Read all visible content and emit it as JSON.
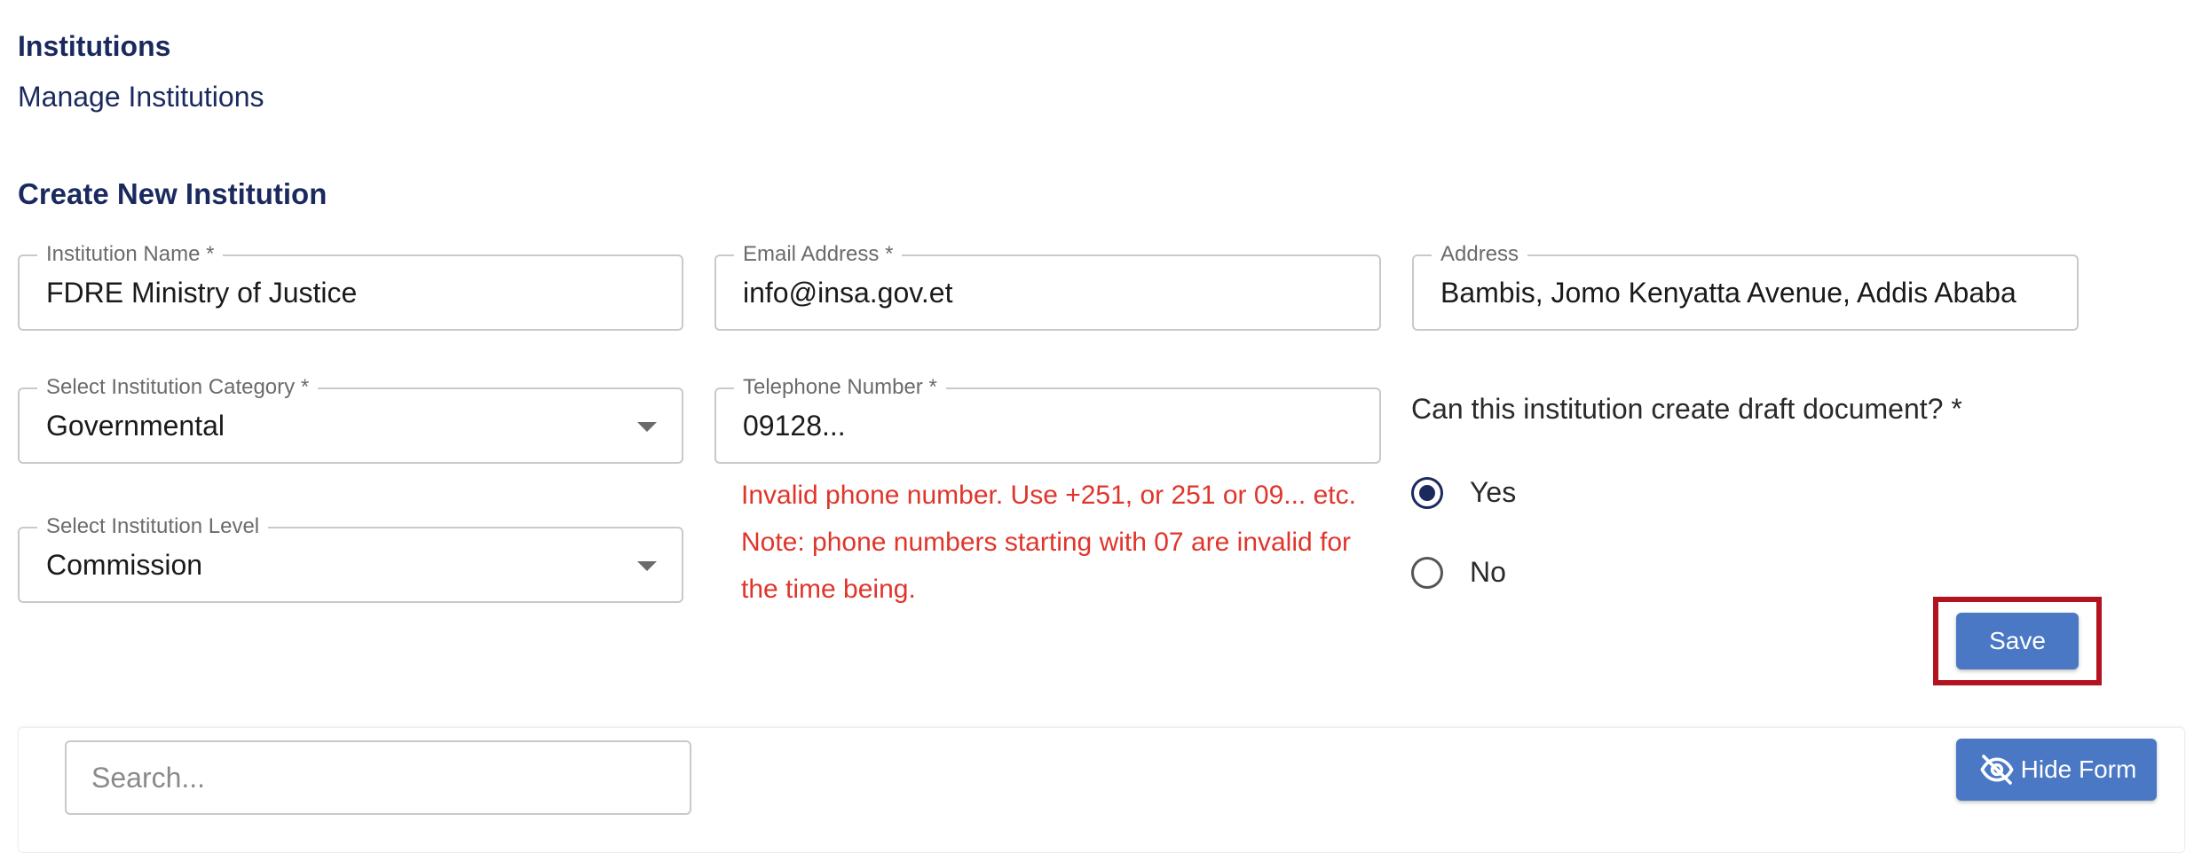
{
  "header": {
    "title": "Institutions",
    "subtitle": "Manage Institutions"
  },
  "form": {
    "section_title": "Create New Institution",
    "institution_name": {
      "label": "Institution Name *",
      "value": "FDRE Ministry of Justice"
    },
    "email": {
      "label": "Email Address *",
      "value": "info@insa.gov.et"
    },
    "address": {
      "label": "Address",
      "value": "Bambis, Jomo Kenyatta Avenue, Addis Ababa"
    },
    "category": {
      "label": "Select Institution Category *",
      "value": "Governmental"
    },
    "telephone": {
      "label": "Telephone Number *",
      "value": "09128..."
    },
    "level": {
      "label": "Select Institution Level",
      "value": "Commission"
    },
    "phone_error": "Invalid phone number. Use +251, or 251 or 09... etc. Note: phone numbers starting with 07 are invalid for the time being.",
    "draft_question": "Can this institution create draft document? *",
    "draft_options": [
      {
        "label": "Yes",
        "selected": true
      },
      {
        "label": "No",
        "selected": false
      }
    ],
    "save_label": "Save"
  },
  "list": {
    "search_placeholder": "Search...",
    "hide_form_label": "Hide Form",
    "hide_form_icon": "eye-off-icon"
  },
  "colors": {
    "primary": "#1b2a5e",
    "button": "#4a78c4",
    "error": "#e0352b",
    "highlight": "#b3121f"
  }
}
